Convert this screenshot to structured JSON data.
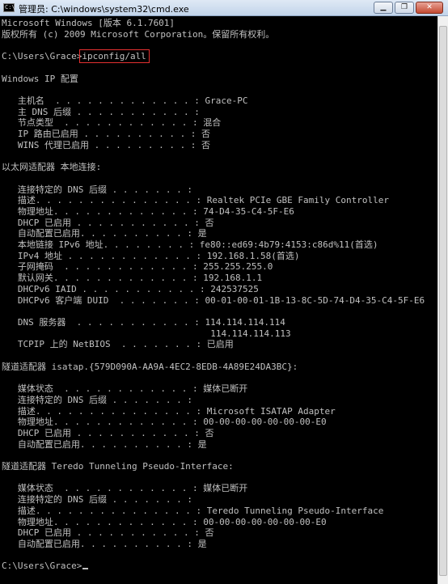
{
  "window": {
    "title": "管理员: C:\\windows\\system32\\cmd.exe",
    "icon_label": "C:\\",
    "minimize_symbol": "▁",
    "maximize_symbol": "❐",
    "close_symbol": "✕"
  },
  "console": {
    "lines": [
      "Microsoft Windows [版本 6.1.7601]",
      "版权所有 (c) 2009 Microsoft Corporation。保留所有权利。",
      "",
      "C:\\Users\\Grace>ipconfig/all",
      "",
      "Windows IP 配置",
      "",
      "   主机名  . . . . . . . . . . . . . : Grace-PC",
      "   主 DNS 后缀 . . . . . . . . . . . :",
      "   节点类型  . . . . . . . . . . . . : 混合",
      "   IP 路由已启用 . . . . . . . . . . : 否",
      "   WINS 代理已启用 . . . . . . . . . : 否",
      "",
      "以太网适配器 本地连接:",
      "",
      "   连接特定的 DNS 后缀 . . . . . . . :",
      "   描述. . . . . . . . . . . . . . . : Realtek PCIe GBE Family Controller",
      "   物理地址. . . . . . . . . . . . . : 74-D4-35-C4-5F-E6",
      "   DHCP 已启用 . . . . . . . . . . . : 否",
      "   自动配置已启用. . . . . . . . . . : 是",
      "   本地链接 IPv6 地址. . . . . . . . : fe80::ed69:4b79:4153:c86d%11(首选)",
      "   IPv4 地址 . . . . . . . . . . . . : 192.168.1.58(首选)",
      "   子网掩码  . . . . . . . . . . . . : 255.255.255.0",
      "   默认网关. . . . . . . . . . . . . : 192.168.1.1",
      "   DHCPv6 IAID . . . . . . . . . . . : 242537525",
      "   DHCPv6 客户端 DUID  . . . . . . . : 00-01-00-01-1B-13-8C-5D-74-D4-35-C4-5F-E6",
      "",
      "   DNS 服务器  . . . . . . . . . . . : 114.114.114.114",
      "                                       114.114.114.113",
      "   TCPIP 上的 NetBIOS  . . . . . . . : 已启用",
      "",
      "隧道适配器 isatap.{579D090A-AA9A-4EC2-8EDB-4A89E24DA3BC}:",
      "",
      "   媒体状态  . . . . . . . . . . . . : 媒体已断开",
      "   连接特定的 DNS 后缀 . . . . . . . :",
      "   描述. . . . . . . . . . . . . . . : Microsoft ISATAP Adapter",
      "   物理地址. . . . . . . . . . . . . : 00-00-00-00-00-00-00-E0",
      "   DHCP 已启用 . . . . . . . . . . . : 否",
      "   自动配置已启用. . . . . . . . . . : 是",
      "",
      "隧道适配器 Teredo Tunneling Pseudo-Interface:",
      "",
      "   媒体状态  . . . . . . . . . . . . : 媒体已断开",
      "   连接特定的 DNS 后缀 . . . . . . . :",
      "   描述. . . . . . . . . . . . . . . : Teredo Tunneling Pseudo-Interface",
      "   物理地址. . . . . . . . . . . . . : 00-00-00-00-00-00-00-E0",
      "   DHCP 已启用 . . . . . . . . . . . : 否",
      "   自动配置已启用. . . . . . . . . . : 是",
      "",
      "C:\\Users\\Grace>"
    ],
    "highlighted_command": "ipconfig/all",
    "highlight_color": "#e53030",
    "text_color": "#c0c0c0",
    "background_color": "#000000"
  }
}
